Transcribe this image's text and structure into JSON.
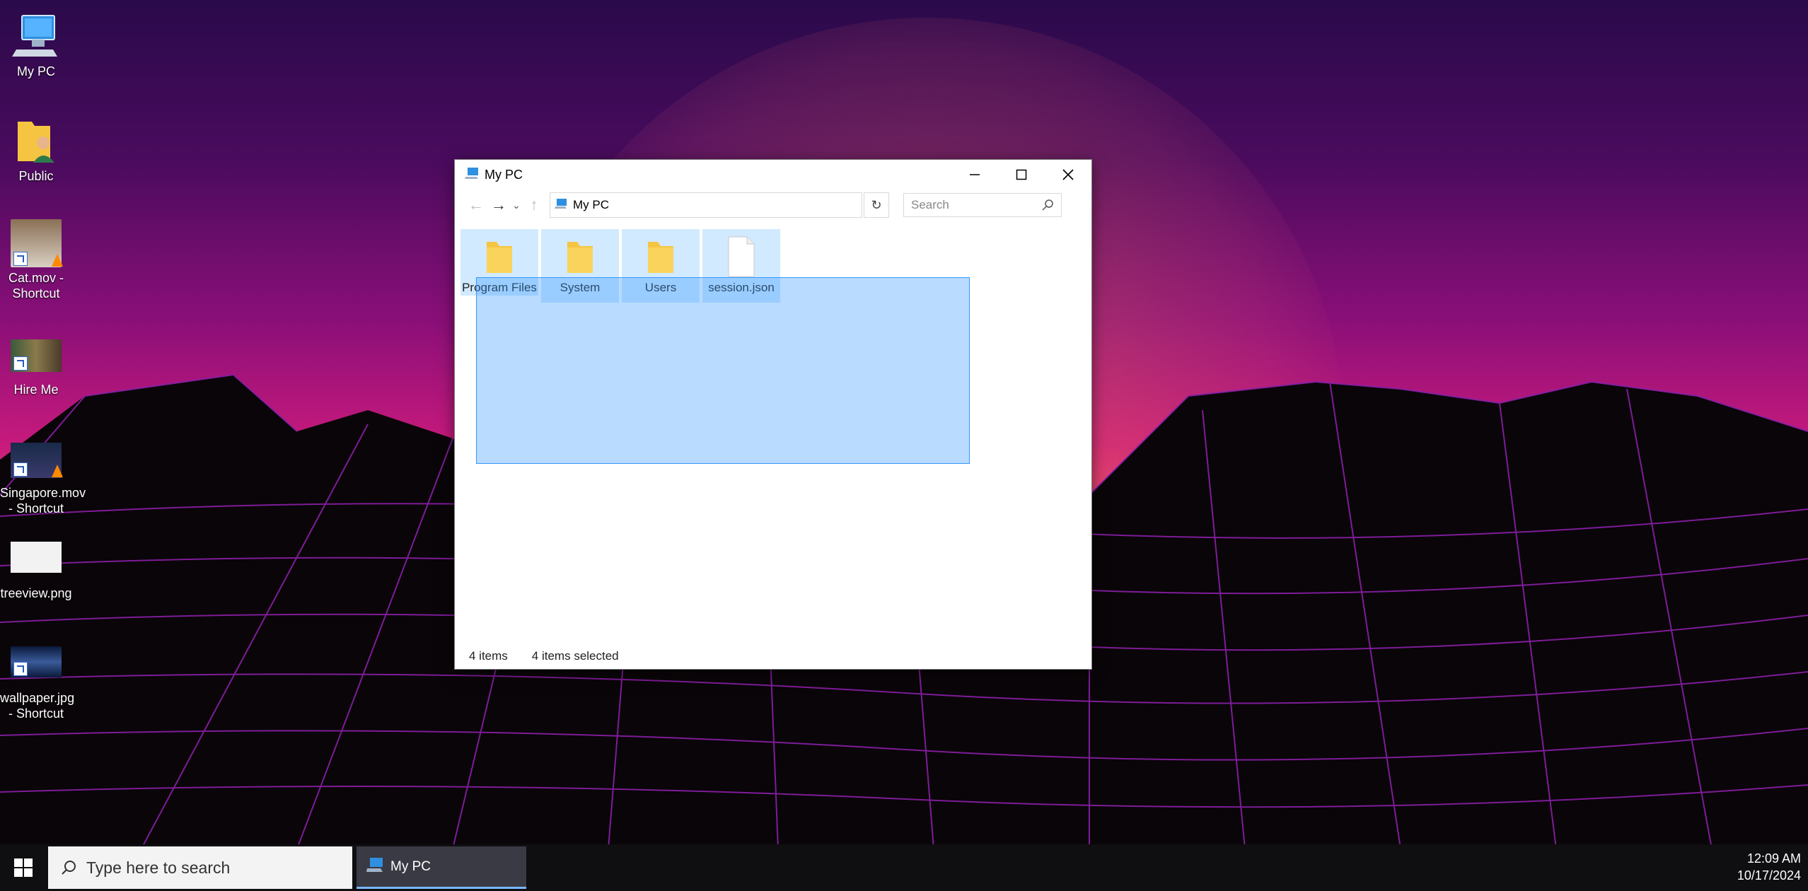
{
  "desktop": {
    "icons": [
      {
        "label": "My PC"
      },
      {
        "label": "Public"
      },
      {
        "label": "Cat.mov - Shortcut"
      },
      {
        "label": "Hire Me"
      },
      {
        "label": "Singapore.mov - Shortcut"
      },
      {
        "label": "treeview.png"
      },
      {
        "label": "wallpaper.jpg - Shortcut"
      }
    ]
  },
  "window": {
    "title": "My PC",
    "address": "My PC",
    "search_placeholder": "Search",
    "items": [
      {
        "label": "Program Files",
        "type": "folder"
      },
      {
        "label": "System",
        "type": "folder"
      },
      {
        "label": "Users",
        "type": "folder"
      },
      {
        "label": "session.json",
        "type": "file"
      }
    ],
    "status": {
      "count": "4 items",
      "selected": "4 items selected"
    }
  },
  "taskbar": {
    "search_placeholder": "Type here to search",
    "app_label": "My PC",
    "time": "12:09 AM",
    "date": "10/17/2024"
  },
  "colors": {
    "selection": "#cce8ff",
    "marquee": "#3399ff",
    "taskbar": "#0f0f12"
  }
}
